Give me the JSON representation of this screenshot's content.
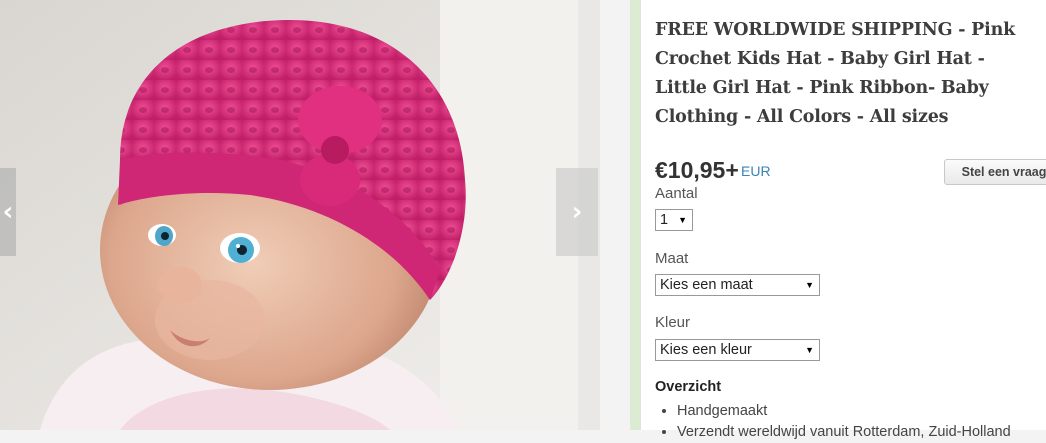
{
  "gallery": {
    "prev_icon": "chevron-left-icon",
    "next_icon": "chevron-right-icon",
    "prev_glyph": "‹",
    "next_glyph": "›"
  },
  "product": {
    "title": "FREE WORLDWIDE SHIPPING - Pink Crochet Kids Hat - Baby Girl Hat - Little Girl Hat - Pink Ribbon- Baby Clothing - All Colors - All sizes",
    "price": "€10,95+",
    "currency": "EUR",
    "ask_button": "Stel een vraag"
  },
  "options": {
    "quantity_label": "Aantal",
    "quantity_value": "1",
    "size_label": "Maat",
    "size_value": "Kies een maat",
    "color_label": "Kleur",
    "color_value": "Kies een kleur"
  },
  "overview": {
    "heading": "Overzicht",
    "items": [
      "Handgemaakt",
      "Verzendt wereldwijd vanuit Rotterdam, Zuid-Holland"
    ]
  },
  "colors": {
    "hat_pink": "#e0307f",
    "panel_border": "#dbecd3",
    "link_blue": "#3a84b6"
  }
}
